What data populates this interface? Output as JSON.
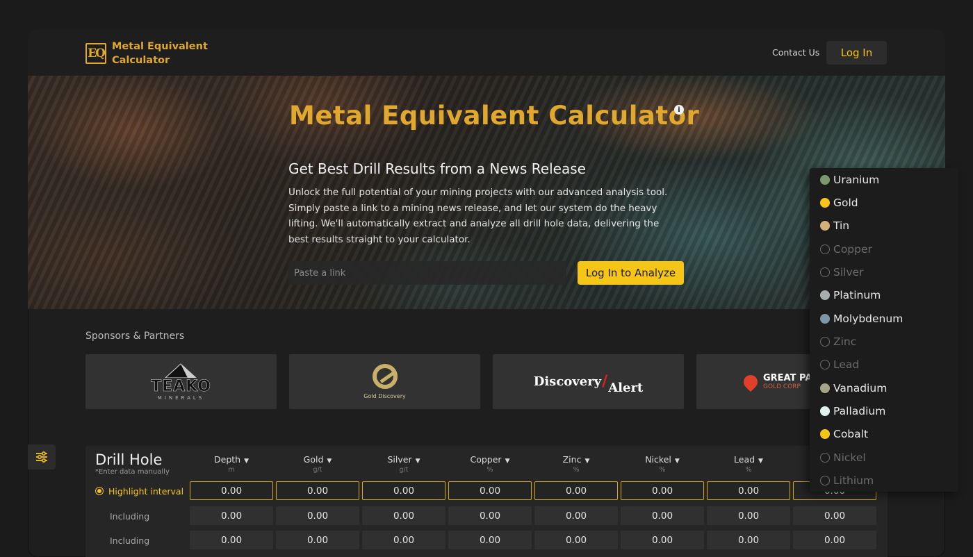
{
  "header": {
    "logo_mark": "EQ",
    "logo_line1": "Metal Equivalent",
    "logo_line2": "Calculator",
    "contact": "Contact Us",
    "login": "Log In"
  },
  "hero": {
    "title": "Metal Equivalent Calculator",
    "info_glyph": "i",
    "subtitle": "Get Best Drill Results from a News Release",
    "description": "Unlock the full potential of your mining projects with our advanced analysis tool. Simply paste a link to a mining news release, and let our system do the heavy lifting. We'll automatically extract and analyze all drill hole data, delivering the best results straight to your calculator.",
    "link_placeholder": "Paste a link",
    "analyze_button": "Log In to Analyze"
  },
  "sponsors": {
    "label": "Sponsors & Partners",
    "items": [
      {
        "name": "TEAKO",
        "sub": "MINERALS"
      },
      {
        "name": "Gold Discovery"
      },
      {
        "name_a": "Discovery",
        "slash": "/",
        "name_b": "Alert"
      },
      {
        "name": "GREAT PANTHER",
        "sub": "GOLD CORP"
      }
    ]
  },
  "table": {
    "title": "Drill Hole",
    "subtitle": "*Enter data manually",
    "columns": [
      {
        "name": "Depth",
        "unit": "m"
      },
      {
        "name": "Gold",
        "unit": "g/t"
      },
      {
        "name": "Silver",
        "unit": "g/t"
      },
      {
        "name": "Copper",
        "unit": "%"
      },
      {
        "name": "Zinc",
        "unit": "%"
      },
      {
        "name": "Nickel",
        "unit": "%"
      },
      {
        "name": "Lead",
        "unit": "%"
      }
    ],
    "rows": [
      {
        "label": "Highlight interval",
        "values": [
          "0.00",
          "0.00",
          "0.00",
          "0.00",
          "0.00",
          "0.00",
          "0.00",
          "0.00"
        ]
      },
      {
        "label": "Including",
        "values": [
          "0.00",
          "0.00",
          "0.00",
          "0.00",
          "0.00",
          "0.00",
          "0.00",
          "0.00"
        ]
      },
      {
        "label": "Including",
        "values": [
          "0.00",
          "0.00",
          "0.00",
          "0.00",
          "0.00",
          "0.00",
          "0.00",
          "0.00"
        ]
      }
    ]
  },
  "metals_dropdown": [
    {
      "name": "Uranium",
      "color": "#7a9a6e",
      "selected": true
    },
    {
      "name": "Gold",
      "color": "#f5c518",
      "selected": true
    },
    {
      "name": "Tin",
      "color": "#d4b07a",
      "selected": true
    },
    {
      "name": "Copper",
      "color": "",
      "selected": false
    },
    {
      "name": "Silver",
      "color": "",
      "selected": false
    },
    {
      "name": "Platinum",
      "color": "#a8aeae",
      "selected": true
    },
    {
      "name": "Molybdenum",
      "color": "#7c98a8",
      "selected": true
    },
    {
      "name": "Zinc",
      "color": "",
      "selected": false
    },
    {
      "name": "Lead",
      "color": "",
      "selected": false
    },
    {
      "name": "Vanadium",
      "color": "#a6a488",
      "selected": true
    },
    {
      "name": "Palladium",
      "color": "#e4f0f0",
      "selected": true
    },
    {
      "name": "Cobalt",
      "color": "#f5c518",
      "selected": true
    },
    {
      "name": "Nickel",
      "color": "",
      "selected": false
    },
    {
      "name": "Lithium",
      "color": "",
      "selected": false
    }
  ],
  "colors": {
    "accent": "#f5c518",
    "logo_gold": "#e0a82e",
    "background": "#1e1e1e"
  }
}
